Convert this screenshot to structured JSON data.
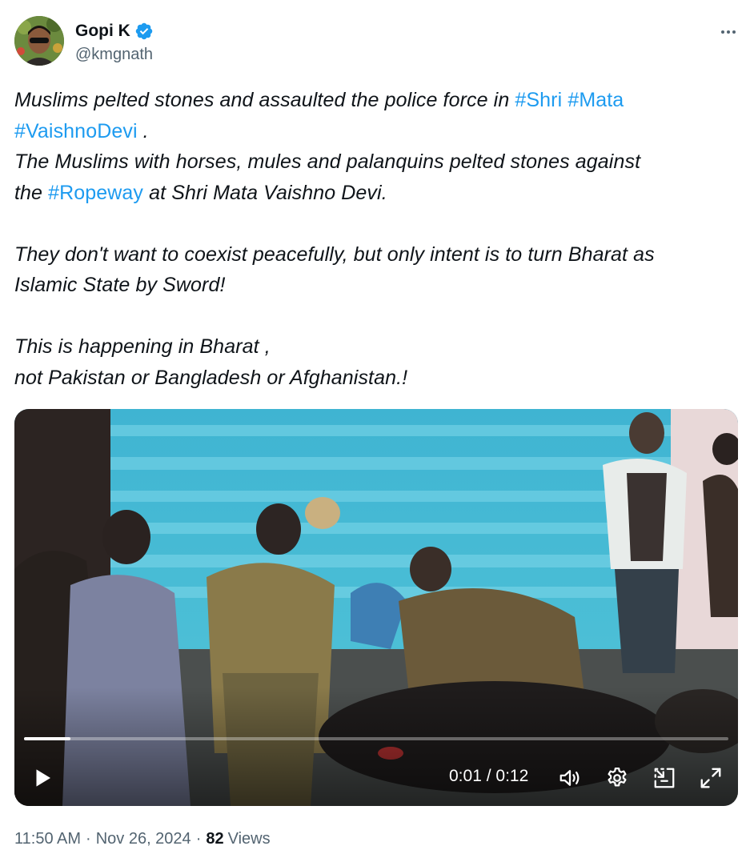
{
  "author": {
    "display_name": "Gopi K",
    "handle": "@kmgnath",
    "verified_icon": "verified-badge-icon",
    "avatar_icon": "avatar"
  },
  "more_icon": "more-horizontal-icon",
  "tweet": {
    "line1_text": "Muslims pelted stones and assaulted the police force in ",
    "hashtag_shri": "#Shri",
    "hashtag_mata": "#Mata",
    "hashtag_vaishnodevi": "#VaishnoDevi",
    "line2_after": " .",
    "line3_text": "The Muslims with horses, mules and palanquins pelted stones against",
    "line4_before": "the ",
    "hashtag_ropeway": "#Ropeway",
    "line4_after": " at Shri Mata Vaishno Devi.",
    "line5_text": "They don't want to coexist peacefully, but only intent is to turn Bharat as",
    "line6_text": "Islamic State by Sword!",
    "line7_text": "This is happening in Bharat ,",
    "line8_text": "not Pakistan or Bangladesh or Afghanistan.!"
  },
  "video": {
    "current_time": "0:01",
    "duration": "0:12",
    "time_separator": " / ",
    "progress_fraction": 0.066,
    "icons": [
      "play-icon",
      "volume-icon",
      "settings-icon",
      "pip-icon",
      "fullscreen-icon"
    ]
  },
  "footer": {
    "time": "11:50 AM",
    "separator": "·",
    "date": "Nov 26, 2024",
    "views_count": "82",
    "views_label": "Views"
  },
  "colors": {
    "hashtag": "#1d9bf0",
    "verified": "#1d9bf0",
    "text_primary": "#0f1419",
    "text_secondary": "#536471"
  }
}
